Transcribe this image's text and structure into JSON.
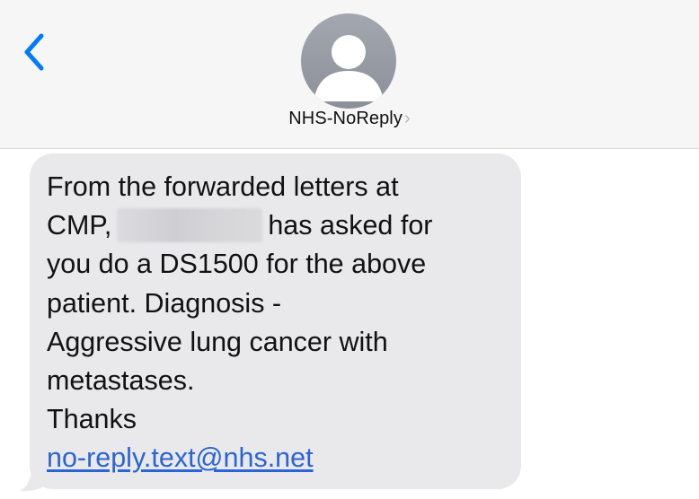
{
  "header": {
    "contact_name": "NHS-NoReply",
    "chevron": "›",
    "back_icon": "chevron-left-icon",
    "avatar_icon": "person-placeholder-icon"
  },
  "message": {
    "line1": "From the forwarded letters at",
    "line2_prefix": "CMP,",
    "line2_suffix": "has asked for",
    "line3": "you do a DS1500 for the above",
    "line4": "patient.  Diagnosis -",
    "line5": "Aggressive lung cancer with",
    "line6": "metastases.",
    "line7": "Thanks",
    "email": "no-reply.text@nhs.net"
  },
  "colors": {
    "accent": "#007aff",
    "bubble": "#e9e9eb",
    "link": "#2b64d6",
    "header_bg": "#f6f6f6"
  }
}
